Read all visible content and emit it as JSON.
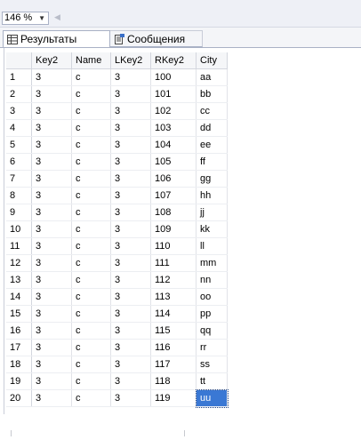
{
  "zoom": {
    "value": "146 %"
  },
  "tabs": {
    "results_label": "Результаты",
    "messages_label": "Сообщения"
  },
  "table": {
    "columns": [
      "",
      "Key2",
      "Name",
      "LKey2",
      "RKey2",
      "City"
    ],
    "rows": [
      [
        "1",
        "3",
        "c",
        "3",
        "100",
        "aa"
      ],
      [
        "2",
        "3",
        "c",
        "3",
        "101",
        "bb"
      ],
      [
        "3",
        "3",
        "c",
        "3",
        "102",
        "cc"
      ],
      [
        "4",
        "3",
        "c",
        "3",
        "103",
        "dd"
      ],
      [
        "5",
        "3",
        "c",
        "3",
        "104",
        "ee"
      ],
      [
        "6",
        "3",
        "c",
        "3",
        "105",
        "ff"
      ],
      [
        "7",
        "3",
        "c",
        "3",
        "106",
        "gg"
      ],
      [
        "8",
        "3",
        "c",
        "3",
        "107",
        "hh"
      ],
      [
        "9",
        "3",
        "c",
        "3",
        "108",
        "jj"
      ],
      [
        "10",
        "3",
        "c",
        "3",
        "109",
        "kk"
      ],
      [
        "11",
        "3",
        "c",
        "3",
        "110",
        "ll"
      ],
      [
        "12",
        "3",
        "c",
        "3",
        "111",
        "mm"
      ],
      [
        "13",
        "3",
        "c",
        "3",
        "112",
        "nn"
      ],
      [
        "14",
        "3",
        "c",
        "3",
        "113",
        "oo"
      ],
      [
        "15",
        "3",
        "c",
        "3",
        "114",
        "pp"
      ],
      [
        "16",
        "3",
        "c",
        "3",
        "115",
        "qq"
      ],
      [
        "17",
        "3",
        "c",
        "3",
        "116",
        "rr"
      ],
      [
        "18",
        "3",
        "c",
        "3",
        "117",
        "ss"
      ],
      [
        "19",
        "3",
        "c",
        "3",
        "118",
        "tt"
      ],
      [
        "20",
        "3",
        "c",
        "3",
        "119",
        "uu"
      ]
    ]
  },
  "colors": {
    "selected_cell": "#3a78d4",
    "toolbar_bg": "#eef0f6"
  },
  "icons": {
    "results_tab": "grid-icon",
    "messages_tab": "message-document-icon",
    "zoom_dropdown": "chevron-down-icon",
    "scroll_left": "arrow-left-icon"
  }
}
